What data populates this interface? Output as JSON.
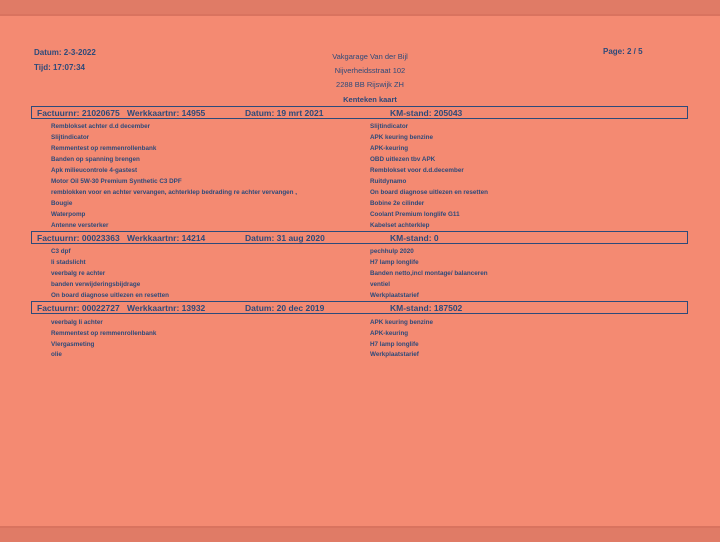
{
  "header": {
    "date": "Datum: 2-3-2022",
    "time": "Tijd: 17:07:34",
    "page": "Page: 2 / 5",
    "company_name": "Vakgarage Van der Bijl",
    "company_street": "Nijverheidsstraat 102",
    "company_city": "2288 BB Rijswijk ZH",
    "subtitle": "Kenteken kaart"
  },
  "invoices": [
    {
      "factuur": "Factuurnr: 21020675",
      "werkkaart": "Werkkaartnr: 14955",
      "datum": "Datum: 19 mrt 2021",
      "km": "KM-stand: 205043",
      "left_items": [
        "Remblokset achter d.d december",
        "Slijtindicator",
        "Remmentest op remmenrollenbank",
        "Banden op spanning brengen",
        "Apk milieucontrole 4-gastest",
        "Motor Oil 5W-30 Premium Synthetic C3 DPF",
        "remblokken voor en achter vervangen, achterklep bedrading re achter vervangen ,",
        "Bougie",
        "Waterpomp",
        "Antenne versterker"
      ],
      "right_items": [
        "Slijtindicator",
        "APK keuring benzine",
        "APK-keuring",
        "OBD uitlezen tbv APK",
        "Remblokset voor d.d.december",
        "Ruitdynamo",
        "On board diagnose  uitlezen en resetten",
        "Bobine 2e cilinder",
        "Coolant Premium longlife G11",
        "Kabelset achterklep"
      ]
    },
    {
      "factuur": "Factuurnr: 00023363",
      "werkkaart": "Werkkaartnr: 14214",
      "datum": "Datum: 31 aug 2020",
      "km": "KM-stand: 0",
      "left_items": [
        "C3 dpf",
        "li stadslicht",
        "veerbalg re achter",
        "banden verwijderingsbijdrage",
        "On board diagnose  uitlezen en resetten"
      ],
      "right_items": [
        "pechhulp 2020",
        "H7 lamp longlife",
        "Banden netto,incl montage/ balanceren",
        "ventiel",
        "Werkplaatstarief"
      ]
    },
    {
      "factuur": "Factuurnr: 00022727",
      "werkkaart": "Werkkaartnr: 13932",
      "datum": "Datum: 20 dec 2019",
      "km": "KM-stand: 187502",
      "left_items": [
        "veerbalg li achter",
        "Remmentest op remmenrollenbank",
        "Vlergasmeting",
        "olie"
      ],
      "right_items": [
        "APK keuring benzine",
        "APK-keuring",
        "H7 lamp longlife",
        "Werkplaatstarief"
      ]
    }
  ]
}
